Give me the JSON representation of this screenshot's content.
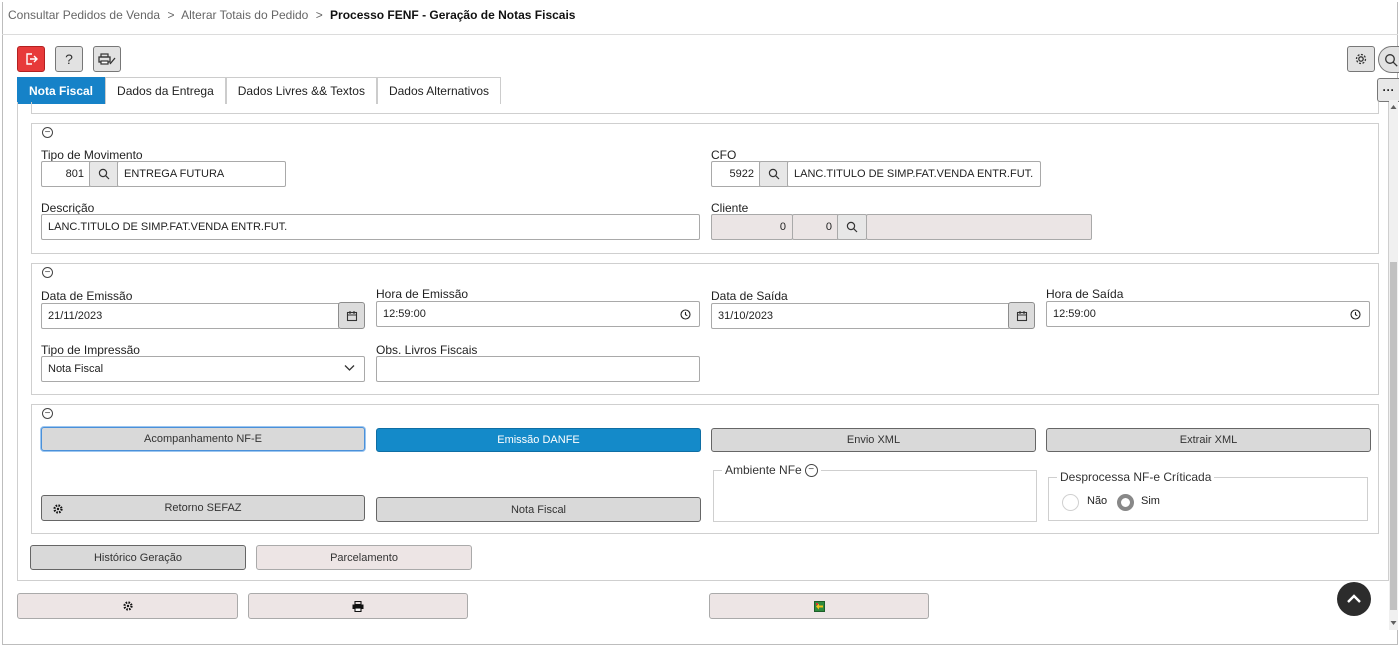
{
  "breadcrumb": {
    "items": [
      "Consultar Pedidos de Venda",
      ">",
      "Alterar Totais do Pedido",
      ">"
    ],
    "current": "Processo FENF - Geração de Notas Fiscais"
  },
  "toolbar": {
    "help_label": "?",
    "settings_icon": "gear-icon",
    "search_icon": "search-icon",
    "more_label": "···"
  },
  "tabs": [
    {
      "label": "Nota Fiscal",
      "active": true
    },
    {
      "label": "Dados da Entrega",
      "active": false
    },
    {
      "label": "Dados Livres && Textos",
      "active": false
    },
    {
      "label": "Dados Alternativos",
      "active": false
    }
  ],
  "section1": {
    "tipo_movimento": {
      "label": "Tipo de Movimento",
      "code": "801",
      "desc": "ENTREGA FUTURA"
    },
    "cfo": {
      "label": "CFO",
      "code": "5922",
      "desc": "LANC.TITULO DE SIMP.FAT.VENDA ENTR.FUT."
    },
    "descricao": {
      "label": "Descrição",
      "value": "LANC.TITULO DE SIMP.FAT.VENDA ENTR.FUT."
    },
    "cliente": {
      "label": "Cliente",
      "code1": "0",
      "code2": "0",
      "name": ""
    }
  },
  "section2": {
    "data_emissao": {
      "label": "Data de Emissão",
      "value": "21/11/2023"
    },
    "hora_emissao": {
      "label": "Hora de Emissão",
      "value": "12:59:00"
    },
    "data_saida": {
      "label": "Data de Saída",
      "value": "31/10/2023"
    },
    "hora_saida": {
      "label": "Hora de Saída",
      "value": "12:59:00"
    },
    "tipo_impressao": {
      "label": "Tipo de Impressão",
      "value": "Nota Fiscal"
    },
    "obs_livros": {
      "label": "Obs. Livros Fiscais",
      "value": ""
    }
  },
  "section3": {
    "acompanhamento": "Acompanhamento NF-E",
    "emissao_danfe": "Emissão DANFE",
    "envio_xml": "Envio XML",
    "extrair_xml": "Extrair XML",
    "ambiente_nfe": "Ambiente NFe",
    "desprocessa": {
      "label": "Desprocessa NF-e Críticada",
      "opt_nao": "Não",
      "opt_sim": "Sim",
      "selected": "Sim"
    },
    "retorno_sefaz": "Retorno SEFAZ",
    "nota_fiscal": "Nota Fiscal"
  },
  "bottom": {
    "historico": "Histórico Geração",
    "parcelamento": "Parcelamento"
  },
  "footer": {
    "settings_icon": "gear-icon",
    "print_icon": "printer-icon",
    "excel_icon": "spreadsheet-export-icon"
  },
  "colors": {
    "accent": "#1682c8",
    "exit_red": "#e73a3a",
    "fab": "#2c2c2c"
  }
}
